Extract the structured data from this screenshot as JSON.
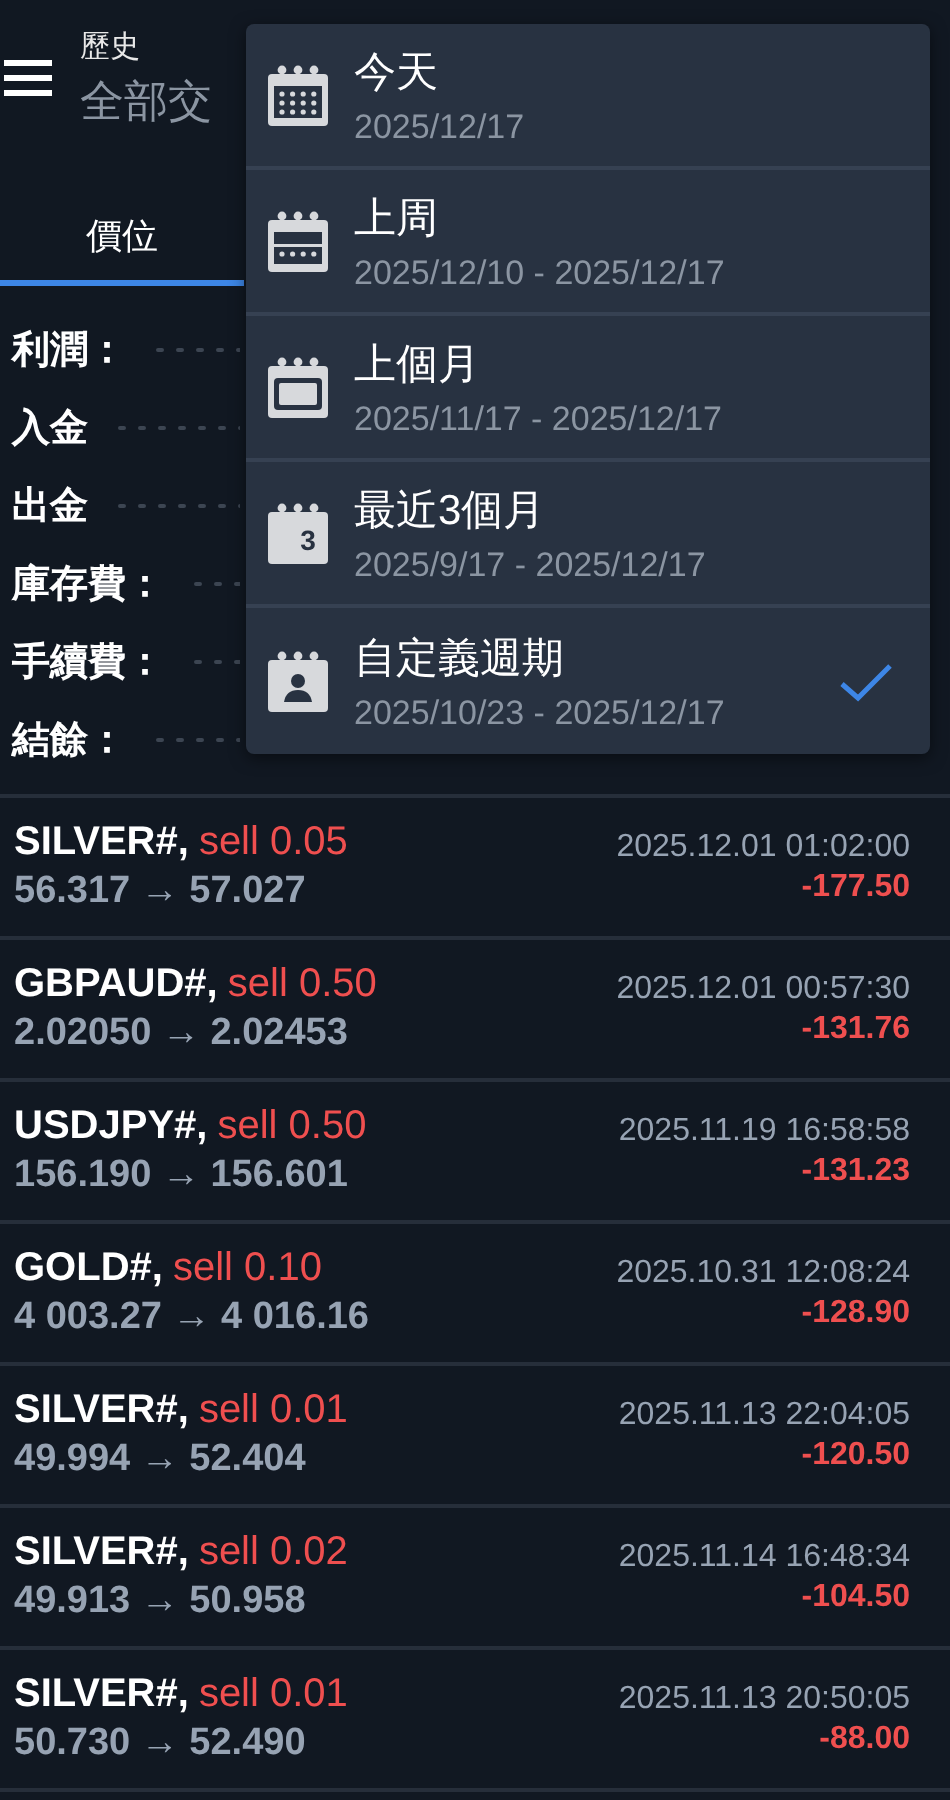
{
  "header": {
    "title": "歷史",
    "subtitle": "全部交"
  },
  "tabs": [
    {
      "label": "價位",
      "selected": true
    }
  ],
  "summary": [
    {
      "label": "利潤："
    },
    {
      "label": "入金"
    },
    {
      "label": "出金"
    },
    {
      "label": "庫存費："
    },
    {
      "label": "手續費："
    },
    {
      "label": "結餘："
    }
  ],
  "trades": [
    {
      "symbol": "SILVER#,",
      "side": "sell 0.05",
      "prices": "56.317 → 57.027",
      "time": "2025.12.01 01:02:00",
      "profit": "-177.50"
    },
    {
      "symbol": "GBPAUD#,",
      "side": "sell 0.50",
      "prices": "2.02050 → 2.02453",
      "time": "2025.12.01 00:57:30",
      "profit": "-131.76"
    },
    {
      "symbol": "USDJPY#,",
      "side": "sell 0.50",
      "prices": "156.190 → 156.601",
      "time": "2025.11.19 16:58:58",
      "profit": "-131.23"
    },
    {
      "symbol": "GOLD#,",
      "side": "sell 0.10",
      "prices": "4 003.27 → 4 016.16",
      "time": "2025.10.31 12:08:24",
      "profit": "-128.90"
    },
    {
      "symbol": "SILVER#,",
      "side": "sell 0.01",
      "prices": "49.994 → 52.404",
      "time": "2025.11.13 22:04:05",
      "profit": "-120.50"
    },
    {
      "symbol": "SILVER#,",
      "side": "sell 0.02",
      "prices": "49.913 → 50.958",
      "time": "2025.11.14 16:48:34",
      "profit": "-104.50"
    },
    {
      "symbol": "SILVER#,",
      "side": "sell 0.01",
      "prices": "50.730 → 52.490",
      "time": "2025.11.13 20:50:05",
      "profit": "-88.00"
    }
  ],
  "period_menu": [
    {
      "kind": "day",
      "label": "今天",
      "range": "2025/12/17",
      "selected": false
    },
    {
      "kind": "week",
      "label": "上周",
      "range": "2025/12/10 - 2025/12/17",
      "selected": false
    },
    {
      "kind": "month",
      "label": "上個月",
      "range": "2025/11/17 - 2025/12/17",
      "selected": false
    },
    {
      "kind": "number",
      "icon_label": "3",
      "label": "最近3個月",
      "range": "2025/9/17 - 2025/12/17",
      "selected": false
    },
    {
      "kind": "custom",
      "label": "自定義週期",
      "range": "2025/10/23 - 2025/12/17",
      "selected": true
    }
  ]
}
